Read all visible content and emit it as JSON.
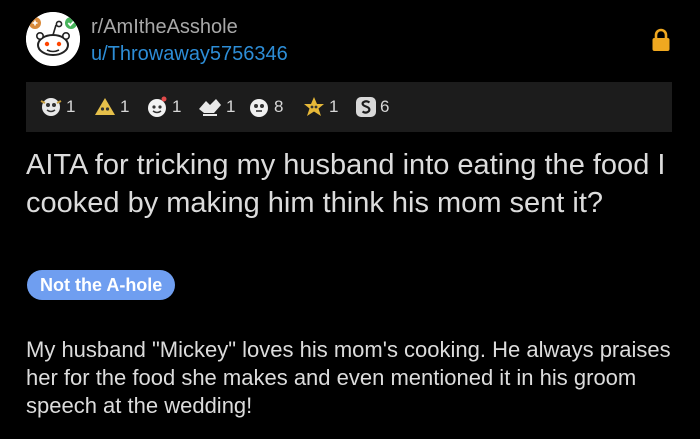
{
  "header": {
    "subreddit": "r/AmItheAsshole",
    "username": "u/Throwaway5756346",
    "avatar_icon": "snoo-icon",
    "lock_icon": "lock-icon"
  },
  "awards": [
    {
      "icon": "award-1-icon",
      "count": "1"
    },
    {
      "icon": "award-2-icon",
      "count": "1"
    },
    {
      "icon": "award-3-icon",
      "count": "1"
    },
    {
      "icon": "award-4-icon",
      "count": "1"
    },
    {
      "icon": "award-5-icon",
      "count": "8"
    },
    {
      "icon": "award-6-icon",
      "count": "1"
    },
    {
      "icon": "award-7-icon",
      "count": "6"
    }
  ],
  "post": {
    "title": "AITA for tricking my husband into eating the food I cooked by making him think his mom sent it?",
    "flair": "Not the A-hole",
    "body": "My husband \"Mickey\" loves his mom's cooking. He always praises her for the food she makes and even mentioned it in his groom speech at the wedding!"
  },
  "colors": {
    "background": "#000000",
    "username": "#2d8dd6",
    "flair": "#6f9ef0",
    "lock": "#f0a820",
    "awards_bar": "#1c1c1c"
  }
}
